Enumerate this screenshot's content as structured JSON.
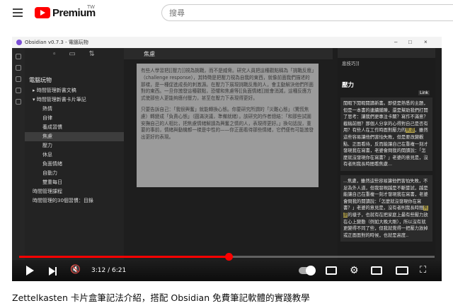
{
  "header": {
    "brand": "Premium",
    "brand_sup": "TW",
    "search_placeholder": "搜尋"
  },
  "app": {
    "title": "Obsidian v0.7.3 - 電腦玩物",
    "window_controls": [
      "–",
      "□",
      "×"
    ],
    "file_tree": {
      "root": "電腦玩物",
      "items": [
        {
          "label": "▸ 時間管理新書文稿",
          "indent": 1,
          "active": false
        },
        {
          "label": "▾ 時間管理新書卡片筆記",
          "indent": 1,
          "active": false
        },
        {
          "label": "熱情",
          "indent": 3,
          "active": false
        },
        {
          "label": "自律",
          "indent": 3,
          "active": false
        },
        {
          "label": "養成習慣",
          "indent": 3,
          "active": false
        },
        {
          "label": "焦慮",
          "indent": 3,
          "active": true
        },
        {
          "label": "壓力",
          "indent": 3,
          "active": false
        },
        {
          "label": "休息",
          "indent": 3,
          "active": false
        },
        {
          "label": "負面情緒",
          "indent": 3,
          "active": false
        },
        {
          "label": "自動力",
          "indent": 3,
          "active": false
        },
        {
          "label": "雙重每日",
          "indent": 3,
          "active": false
        },
        {
          "label": "時間管理課程",
          "indent": 1,
          "active": false
        },
        {
          "label": "時間管理的30個習慣：目錄",
          "indent": 1,
          "active": false
        }
      ]
    },
    "editor": {
      "tab_title": "焦慮",
      "paragraphs": [
        "有些人學習把[[壓力]]視為挑戰，而不是威脅。研究人員把這種觀點稱為「挑戰反應」（challenge response），其特徵是把壓力視為自我的東西，就像前面我們描述的那樣，是一種促進成長的刺激源。在壓力下展現挑戰反應的人，會主動解決他們所面對的東西。一旦你激發這種觀點，恐懼和焦慮等[[負面情緒]]就會消減，這種反應方式使那些人更能夠應付壓力，甚至在壓力下表現得更好。",
        "只要告訴自己：「我很興奮」就能轉換心態。你要研究所謂的「災難心態」（驚慌焦慮）轉變成「負責心態」（圓滿決議，準備就緒）。該研究的作者總結：「和那些試圖安撫自己的人相比，把焦慮情緒解讀為興奮之情的人，表現得更好。」換句話說，重要的事前，情緒與動機都一樣是中性的——你正面看待那些情緒，它們便有可能激發出更好的表現。"
      ]
    },
    "right_pane": {
      "header": "息技巧]]",
      "title": "壓力",
      "card1": "閒暇下閒暇閱讀新書。即使是熟悉的主題，但是一本書的連續鋪陳，還是幫助我們打開了思考：讓我們更專注卡關？寫作不滿意？截稿前間？那個人分享的心得對自己是否有用？有些人在工作時面對壓力的",
      "highlight": "焦慮",
      "card1_tail": "，雖然這些容易讓他們害怕失敗，但是要改變觀點、正面看待，反而能讓自己在重複一刻才發現我在寫書，老婆會問我的閱讀說：「怎麼就沒發現你在寫書？」老婆的意見是，沒有者則我長時間看焦慮...",
      "card2": "...焦慮，雖然這些容易讓他們害怕失敗，不足為外人道，但我發現越是不斷嘗試，越是能讓自己在重複一刻才發現我在寫書，老婆會問我的閱讀說：「怎麼就沒發現你在寫書？」老婆的意見是，沒有者則我長時間",
      "highlight2": "焦慮",
      "card2_tail": "的樣子，也就有在把家庭上最有些壓力放在心上變動（例如大晚大剛），所以沒有就更變得不同了些，但我就覺得一把壓力放掉或正面面對的時候，也就是高度..",
      "link_badge": "Link"
    }
  },
  "player": {
    "time_label": "3:12 / 6:21",
    "progress": 0.5039,
    "accent": "#ff0000"
  },
  "video": {
    "title": "Zettelkasten 卡片盒筆記法介紹，搭配 Obsidian 免費筆記軟體的實踐教學"
  },
  "icons": [
    "hamburger-icon",
    "youtube-logo-icon",
    "play-icon",
    "next-icon",
    "mute-icon",
    "autoplay-toggle",
    "subtitles-icon",
    "settings-icon",
    "miniplayer-icon",
    "theater-icon",
    "fullscreen-icon"
  ]
}
